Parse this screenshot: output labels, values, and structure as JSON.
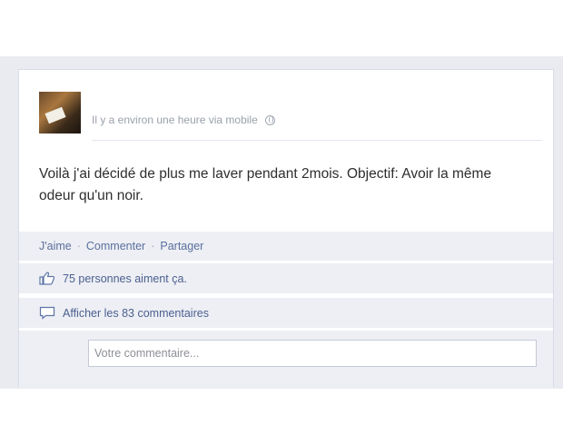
{
  "post": {
    "meta": "Il y a environ une heure via mobile",
    "text": "Voilà j'ai décidé de plus me laver pendant 2mois. Objectif: Avoir la même odeur qu'un noir."
  },
  "actions": {
    "like": "J'aime",
    "comment": "Commenter",
    "share": "Partager",
    "separator": "·"
  },
  "likes": {
    "text": "75 personnes aiment ça."
  },
  "comments": {
    "show_all": "Afficher les 83 commentaires"
  },
  "comment_box": {
    "placeholder": "Votre commentaire..."
  },
  "colors": {
    "link": "#5b6f9c",
    "panel": "#edeff4"
  },
  "icons": [
    "globe-icon",
    "thumbs-up-icon",
    "comment-bubble-icon"
  ]
}
